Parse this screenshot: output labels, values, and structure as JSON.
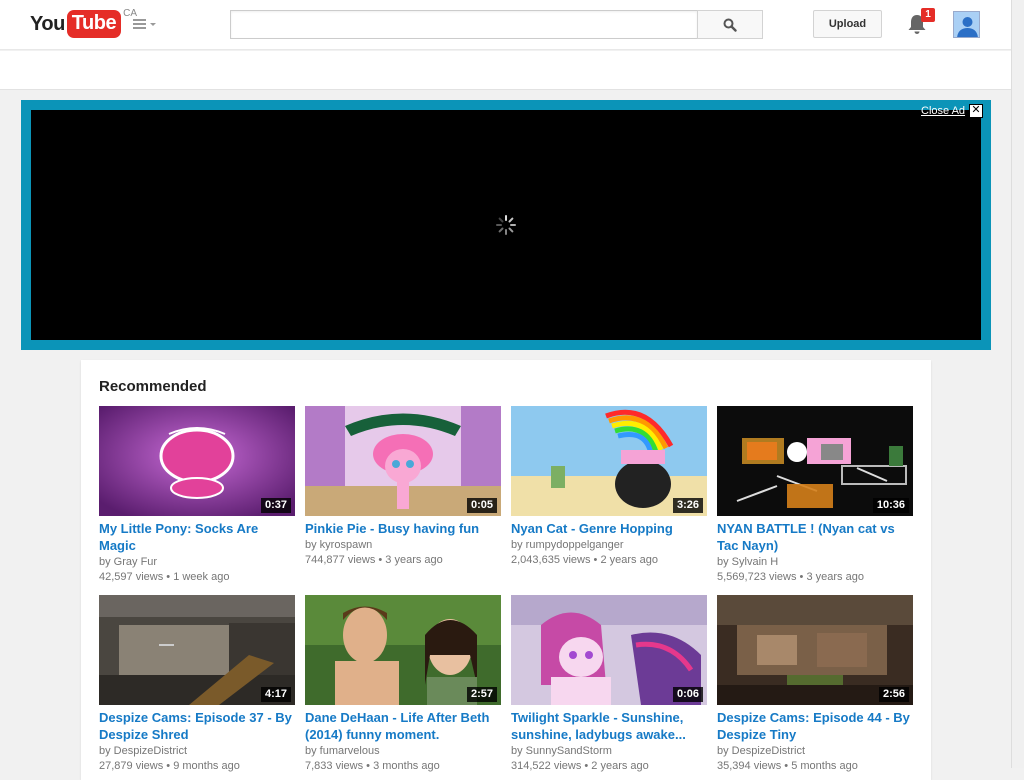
{
  "header": {
    "logo_you": "You",
    "logo_tube": "Tube",
    "logo_country": "CA",
    "search_placeholder": "",
    "upload_label": "Upload",
    "notification_count": "1"
  },
  "ad": {
    "close_label": "Close Ad",
    "close_x": "✕"
  },
  "feed": {
    "title": "Recommended",
    "videos": [
      {
        "title": "My Little Pony: Socks Are Magic",
        "channel": "by Gray Fur",
        "views": "42,597 views",
        "age": "1 week ago",
        "duration": "0:37"
      },
      {
        "title": "Pinkie Pie - Busy having fun",
        "channel": "by kyrospawn",
        "views": "744,877 views",
        "age": "3 years ago",
        "duration": "0:05"
      },
      {
        "title": "Nyan Cat - Genre Hopping",
        "channel": "by rumpydoppelganger",
        "views": "2,043,635 views",
        "age": "2 years ago",
        "duration": "3:26"
      },
      {
        "title": "NYAN BATTLE ! (Nyan cat vs Tac Nayn)",
        "channel": "by Sylvain H",
        "views": "5,569,723 views",
        "age": "3 years ago",
        "duration": "10:36"
      },
      {
        "title": "Despize Cams: Episode 37 - By Despize Shred",
        "channel": "by DespizeDistrict",
        "views": "27,879 views",
        "age": "9 months ago",
        "duration": "4:17"
      },
      {
        "title": "Dane DeHaan - Life After Beth (2014) funny moment.",
        "channel": "by fumarvelous",
        "views": "7,833 views",
        "age": "3 months ago",
        "duration": "2:57"
      },
      {
        "title": "Twilight Sparkle - Sunshine, sunshine, ladybugs awake...",
        "channel": "by SunnySandStorm",
        "views": "314,522 views",
        "age": "2 years ago",
        "duration": "0:06"
      },
      {
        "title": "Despize Cams: Episode 44 - By Despize Tiny",
        "channel": "by DespizeDistrict",
        "views": "35,394 views",
        "age": "5 months ago",
        "duration": "2:56"
      }
    ]
  },
  "colors": {
    "brand_red": "#e52d27",
    "link_blue": "#167ac6",
    "ad_border": "#0b94b8"
  }
}
